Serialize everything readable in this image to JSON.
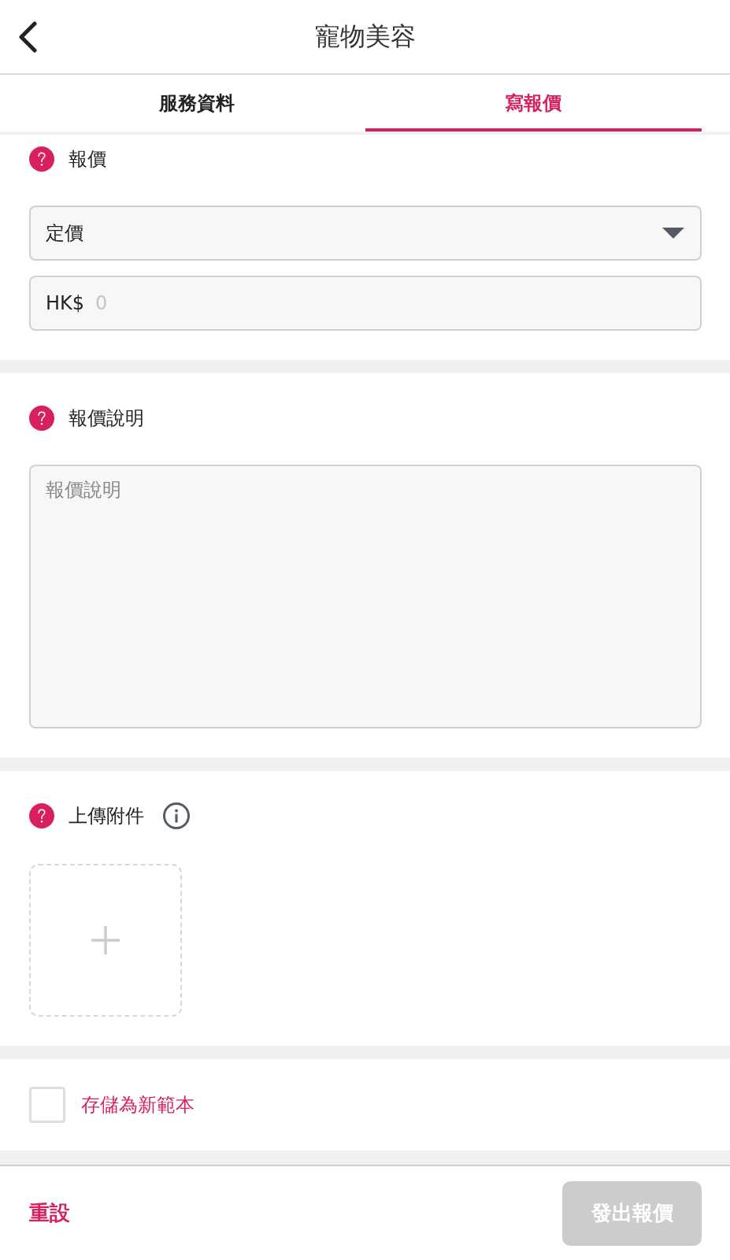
{
  "header": {
    "title": "寵物美容"
  },
  "tabs": [
    {
      "label": "服務資料",
      "selected": false
    },
    {
      "label": "寫報價",
      "selected": true
    }
  ],
  "sections": [
    {
      "kind": "price",
      "label": "報價",
      "select": {
        "value": "定價"
      },
      "amount": {
        "prefix": "HK$",
        "placeholder": "0"
      }
    },
    {
      "kind": "description",
      "label": "報價說明",
      "textarea": {
        "placeholder": "報價說明"
      }
    },
    {
      "kind": "upload",
      "label": "上傳附件"
    }
  ],
  "save_template": {
    "label": "存儲為新範本",
    "checked": false
  },
  "footer": {
    "reset": "重設",
    "submit": {
      "label": "發出報價",
      "disabled": true
    }
  }
}
